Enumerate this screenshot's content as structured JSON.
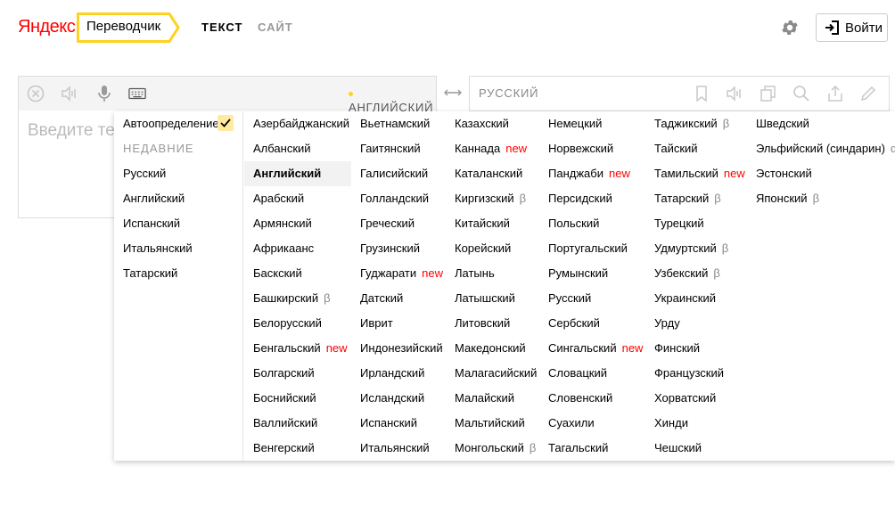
{
  "header": {
    "logo_text": "Яндекс",
    "service_name": "Переводчик",
    "tabs": [
      {
        "label": "ТЕКСТ",
        "active": true
      },
      {
        "label": "САЙТ",
        "active": false
      }
    ],
    "settings_icon": "gear-icon",
    "login_label": "Войти",
    "login_icon": "sign-in-icon"
  },
  "source": {
    "language_label": "АНГЛИЙСКИЙ",
    "placeholder": "Введите те",
    "toolbar_icons": [
      "clear-icon",
      "speaker-icon",
      "microphone-icon",
      "keyboard-icon"
    ]
  },
  "target": {
    "language_label": "РУССКИЙ",
    "toolbar_icons": [
      "bookmark-icon",
      "speaker-icon",
      "copy-icon",
      "search-icon",
      "share-icon",
      "edit-icon"
    ]
  },
  "dropdown": {
    "auto_detect_label": "Автоопределение",
    "recent_title": "НЕДАВНИЕ",
    "recent": [
      "Русский",
      "Английский",
      "Испанский",
      "Итальянский",
      "Татарский"
    ],
    "selected": "Английский",
    "columns": [
      [
        {
          "label": "Азербайджанский"
        },
        {
          "label": "Албанский"
        },
        {
          "label": "Английский",
          "selected": true
        },
        {
          "label": "Арабский"
        },
        {
          "label": "Армянский"
        },
        {
          "label": "Африкаанс"
        },
        {
          "label": "Баскский"
        },
        {
          "label": "Башкирский",
          "badge": "β"
        },
        {
          "label": "Белорусский"
        },
        {
          "label": "Бенгальский",
          "badge": "new"
        },
        {
          "label": "Болгарский"
        },
        {
          "label": "Боснийский"
        },
        {
          "label": "Валлийский"
        },
        {
          "label": "Венгерский"
        }
      ],
      [
        {
          "label": "Вьетнамский"
        },
        {
          "label": "Гаитянский"
        },
        {
          "label": "Галисийский"
        },
        {
          "label": "Голландский"
        },
        {
          "label": "Греческий"
        },
        {
          "label": "Грузинский"
        },
        {
          "label": "Гуджарати",
          "badge": "new"
        },
        {
          "label": "Датский"
        },
        {
          "label": "Иврит"
        },
        {
          "label": "Индонезийский"
        },
        {
          "label": "Ирландский"
        },
        {
          "label": "Исландский"
        },
        {
          "label": "Испанский"
        },
        {
          "label": "Итальянский"
        }
      ],
      [
        {
          "label": "Казахский"
        },
        {
          "label": "Каннада",
          "badge": "new"
        },
        {
          "label": "Каталанский"
        },
        {
          "label": "Киргизский",
          "badge": "β"
        },
        {
          "label": "Китайский"
        },
        {
          "label": "Корейский"
        },
        {
          "label": "Латынь"
        },
        {
          "label": "Латышский"
        },
        {
          "label": "Литовский"
        },
        {
          "label": "Македонский"
        },
        {
          "label": "Малагасийский"
        },
        {
          "label": "Малайский"
        },
        {
          "label": "Мальтийский"
        },
        {
          "label": "Монгольский",
          "badge": "β"
        }
      ],
      [
        {
          "label": "Немецкий"
        },
        {
          "label": "Норвежский"
        },
        {
          "label": "Панджаби",
          "badge": "new"
        },
        {
          "label": "Персидский"
        },
        {
          "label": "Польский"
        },
        {
          "label": "Португальский"
        },
        {
          "label": "Румынский"
        },
        {
          "label": "Русский"
        },
        {
          "label": "Сербский"
        },
        {
          "label": "Сингальский",
          "badge": "new"
        },
        {
          "label": "Словацкий"
        },
        {
          "label": "Словенский"
        },
        {
          "label": "Суахили"
        },
        {
          "label": "Тагальский"
        }
      ],
      [
        {
          "label": "Таджикский",
          "badge": "β"
        },
        {
          "label": "Тайский"
        },
        {
          "label": "Тамильский",
          "badge": "new"
        },
        {
          "label": "Татарский",
          "badge": "β"
        },
        {
          "label": "Турецкий"
        },
        {
          "label": "Удмуртский",
          "badge": "β"
        },
        {
          "label": "Узбекский",
          "badge": "β"
        },
        {
          "label": "Украинский"
        },
        {
          "label": "Урду"
        },
        {
          "label": "Финский"
        },
        {
          "label": "Французский"
        },
        {
          "label": "Хорватский"
        },
        {
          "label": "Хинди"
        },
        {
          "label": "Чешский"
        }
      ],
      [
        {
          "label": "Шведский"
        },
        {
          "label": "Эльфийский (синдарин)",
          "badge": "α"
        },
        {
          "label": "Эстонский"
        },
        {
          "label": "Японский",
          "badge": "β"
        }
      ]
    ]
  },
  "colors": {
    "brand_red": "#ff0000",
    "brand_yellow": "#ffd21f",
    "new_badge": "#ff0000"
  }
}
